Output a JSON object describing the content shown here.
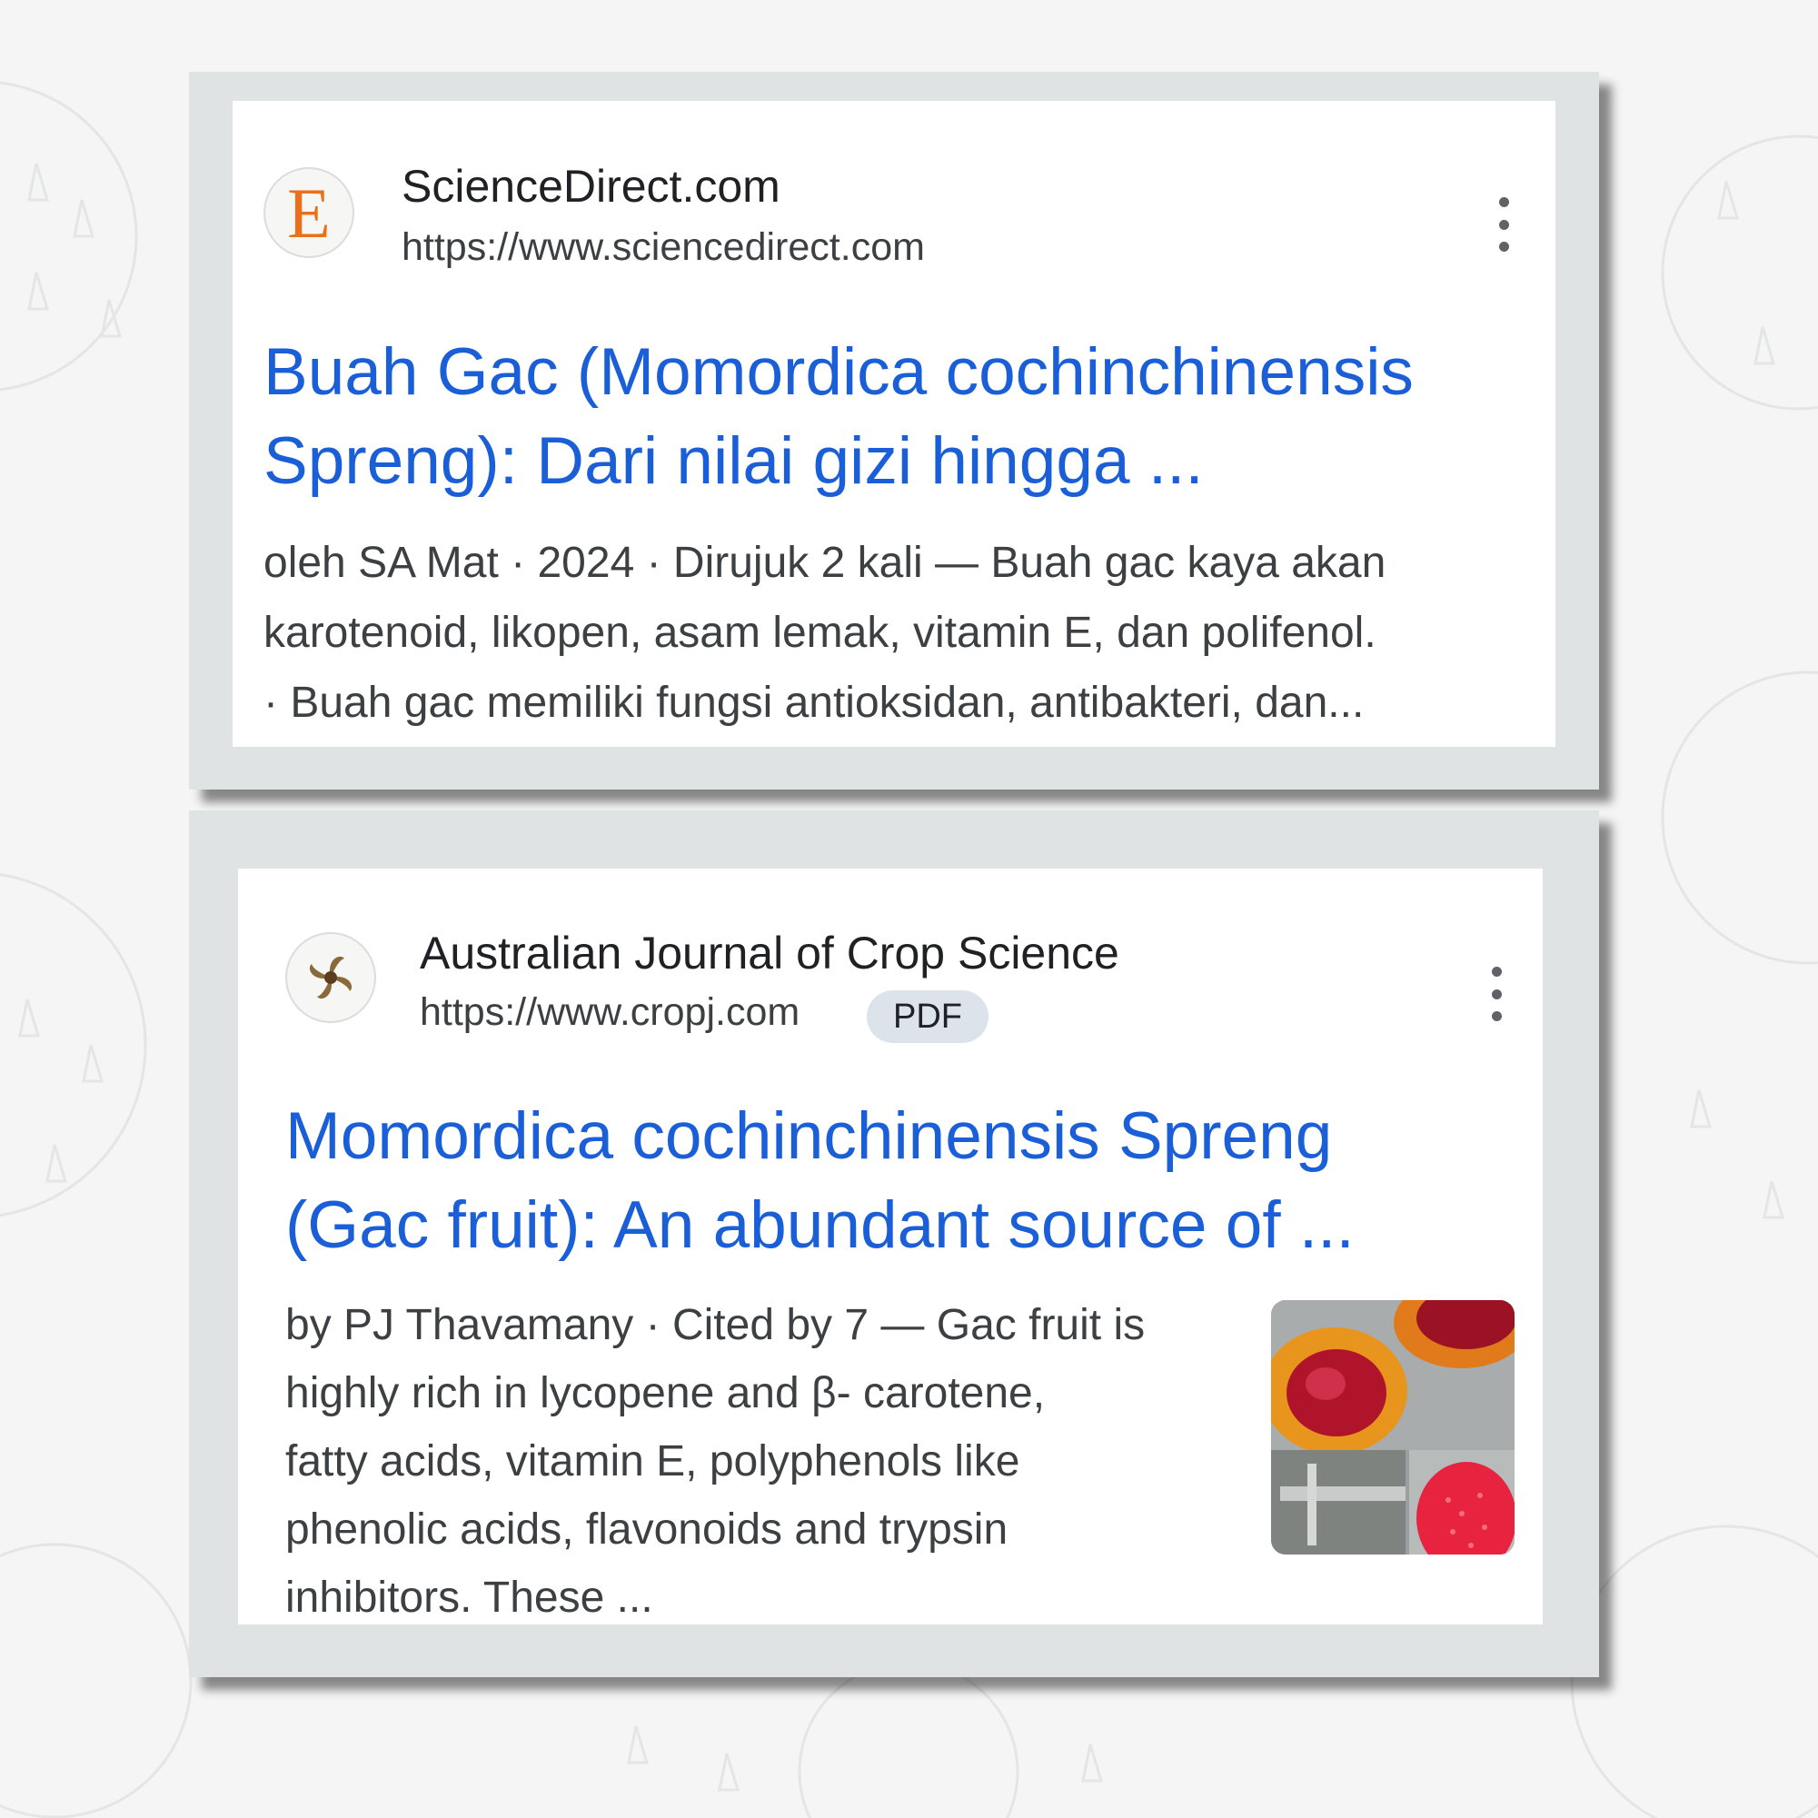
{
  "results": [
    {
      "site_name": "ScienceDirect.com",
      "url": "https://www.sciencedirect.com",
      "favicon": {
        "icon": "elsevier-e-icon",
        "letter": "E",
        "color": "#e9711c"
      },
      "title_lines": [
        "Buah Gac (Momordica cochinchinensis",
        "Spreng): Dari nilai gizi hingga ..."
      ],
      "snippet_lines": [
        "oleh SA Mat · 2024 · Dirujuk 2 kali — Buah gac kaya akan",
        "karotenoid, likopen, asam lemak, vitamin E, dan polifenol.",
        "· Buah gac memiliki fungsi antioksidan, antibakteri, dan..."
      ]
    },
    {
      "site_name": "Australian Journal of Crop Science",
      "url": "https://www.cropj.com",
      "badge": "PDF",
      "favicon": {
        "icon": "crop-science-logo-icon"
      },
      "title_lines": [
        "Momordica cochinchinensis Spreng",
        "(Gac fruit): An abundant source of ..."
      ],
      "snippet_lines": [
        "by PJ Thavamany · Cited by 7 — Gac fruit is",
        "highly rich in lycopene and β- carotene,",
        "fatty acids, vitamin E, polyphenols like",
        "phenolic acids, flavonoids and trypsin",
        "inhibitors. These ..."
      ],
      "thumbnail": {
        "icon": "gac-fruit-thumbnail"
      }
    }
  ],
  "colors": {
    "title_link": "#1a5fd8",
    "snippet_text": "#3c4043",
    "frame": "#dfe3e3",
    "badge_bg": "#dce3ea"
  }
}
